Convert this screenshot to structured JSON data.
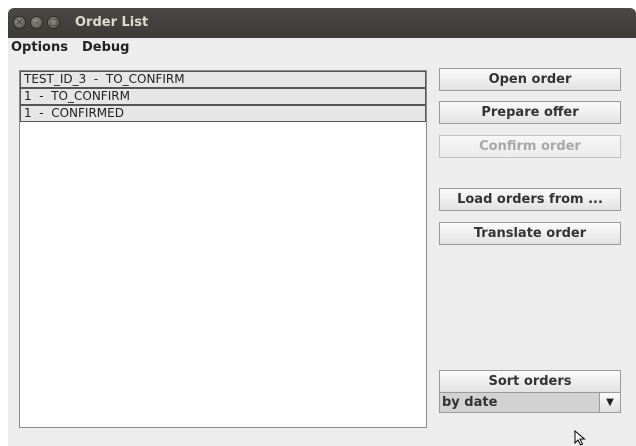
{
  "window": {
    "title": "Order List"
  },
  "menu": {
    "items": [
      "Options",
      "Debug"
    ]
  },
  "orders": [
    "TEST_ID_3  -  TO_CONFIRM",
    "1  -  TO_CONFIRM",
    "1  -  CONFIRMED"
  ],
  "buttons": {
    "open_order": "Open order",
    "prepare_offer": "Prepare offer",
    "confirm_order": "Confirm order",
    "load_orders": "Load orders from ...",
    "translate_order": "Translate order",
    "sort_orders": "Sort orders"
  },
  "sort": {
    "selected": "by date"
  },
  "icons": {
    "close": "close-icon",
    "minimize": "minimize-icon",
    "maximize": "maximize-icon",
    "dropdown": "chevron-down-icon",
    "cursor": "mouse-pointer-icon"
  }
}
